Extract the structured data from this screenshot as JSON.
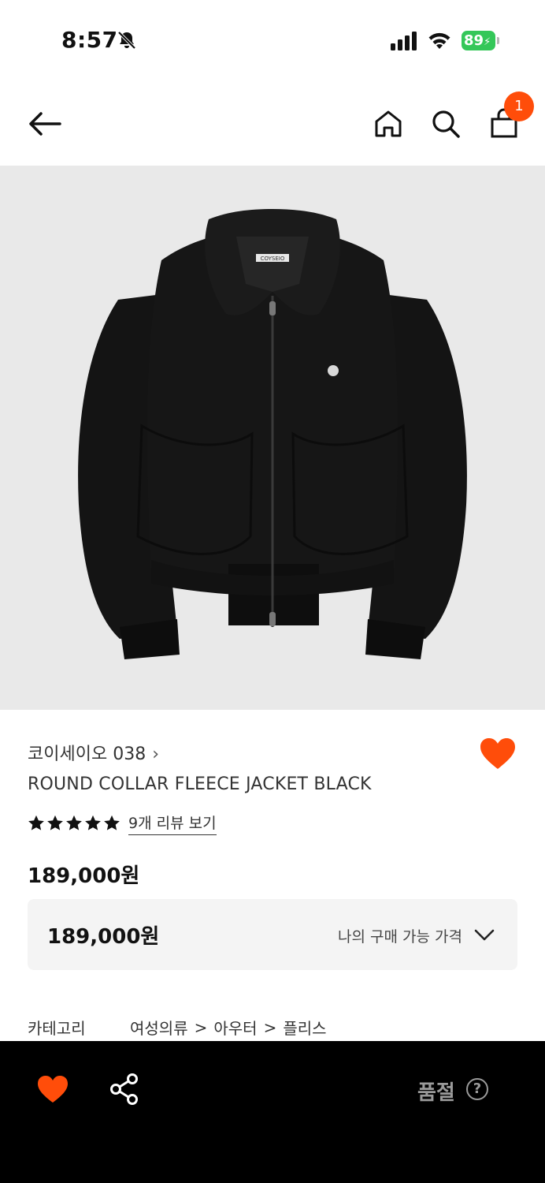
{
  "status_bar": {
    "time": "8:57",
    "battery_level": "89",
    "icons": [
      "bell-slash-icon",
      "signal-icon",
      "wifi-icon",
      "battery-charging-icon"
    ]
  },
  "header": {
    "icons": [
      "back-arrow-icon",
      "home-icon",
      "search-icon",
      "shopping-bag-icon"
    ],
    "cart_count": "1",
    "accent_color": "#ff4d0a"
  },
  "product": {
    "image_label": "COYSEIO",
    "brand": "코이세이오 038",
    "brand_chevron": "›",
    "name": "ROUND COLLAR FLEECE JACKET BLACK",
    "rating_stars": 5,
    "review_link": "9개 리뷰 보기",
    "price": "189,000원",
    "price_box": {
      "value": "189,000원",
      "label": "나의 구매 가능 가격"
    },
    "category": {
      "label": "카테고리",
      "path": [
        "여성의류",
        "아우터",
        "플리스"
      ],
      "separator": ">"
    }
  },
  "bottom_bar": {
    "sold_out_label": "품절",
    "help_glyph": "?",
    "icons": [
      "heart-icon",
      "share-icon",
      "help-circle-icon"
    ]
  }
}
